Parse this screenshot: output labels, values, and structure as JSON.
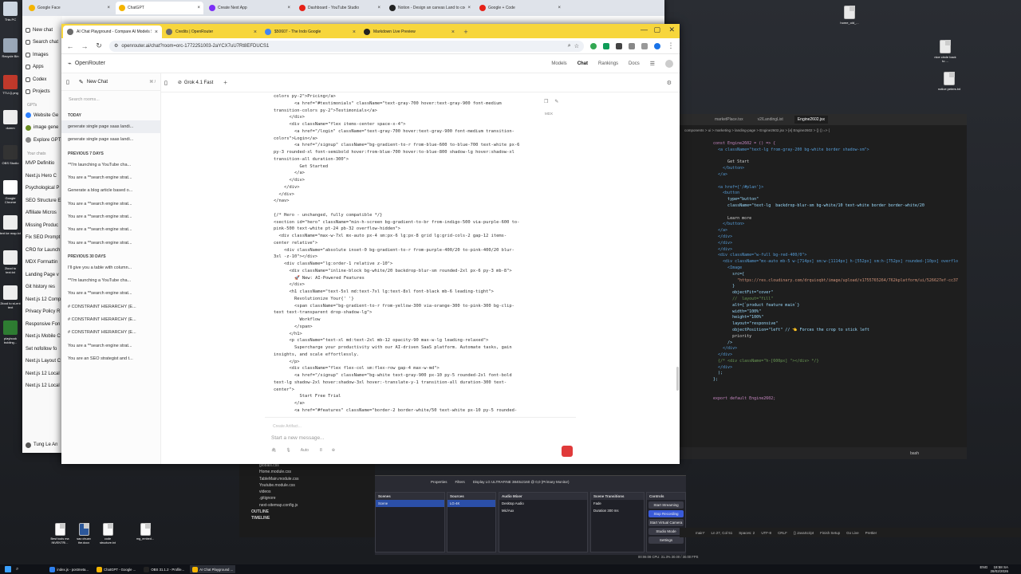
{
  "desktop": {
    "left_icons": [
      {
        "label": "This PC"
      },
      {
        "label": "Recycle Bin"
      },
      {
        "label": "TTU.Q.png"
      },
      {
        "label": "dumm"
      },
      {
        "label": "OBS Studio"
      },
      {
        "label": "Google Chrome"
      },
      {
        "label": "text ke map.txt"
      },
      {
        "label": "2lood to text.txt"
      },
      {
        "label": "2lood to st-ent text"
      },
      {
        "label": "playbook bulding..."
      }
    ],
    "right_icons": [
      {
        "label": "home_old_..."
      },
      {
        "label": "nice circle back to ..."
      },
      {
        "label": "notice peters.txt"
      }
    ],
    "bottom_icons": [
      {
        "label": "Best tools ma INVENTRI..."
      },
      {
        "label": "sao chuan the.docx"
      },
      {
        "label": "code structure.txt"
      },
      {
        "label": "mg_embed..."
      }
    ]
  },
  "chatgpt_window": {
    "tabs": [
      {
        "label": "Google Face",
        "color": "#f4b400",
        "active": false
      },
      {
        "label": "ChatGPT",
        "color": "#f4b400",
        "active": true
      },
      {
        "label": "Create Next App",
        "color": "#7b2ff7",
        "active": false
      },
      {
        "label": "Dashboard - YouTube Studio",
        "color": "#e62117",
        "active": false
      },
      {
        "label": "Notion - Design an canvas Land to code",
        "color": "#222222",
        "active": false
      },
      {
        "label": "Google + Code",
        "color": "#e62117",
        "active": false
      }
    ],
    "sidebar": [
      {
        "label": "New chat"
      },
      {
        "label": "Search chat"
      },
      {
        "label": "Images"
      },
      {
        "label": "Apps"
      },
      {
        "label": "Codex"
      },
      {
        "label": "Projects"
      }
    ],
    "gpts_heading": "GPTs",
    "gpts": [
      {
        "label": "Website Ge"
      },
      {
        "label": "image gene"
      },
      {
        "label": "Explore GPT"
      }
    ],
    "chats_heading": "Your chats",
    "chats": [
      "MVP Definitio",
      "Next.js Hero C",
      "Psychological P",
      "SEO Structure E",
      "Affiliate Micros",
      "Missing Produc",
      "Fix SEO Prompt",
      "CRO for Launch",
      "MDX Formattin",
      "Landing Page v",
      "Git history res",
      "Next.js 12 Comp",
      "Privacy Policy R",
      "Responsive Fon",
      "Next.js Mobile C",
      "Set nofollow fo",
      "Next.js Layout C",
      "Next.js 12 Local",
      "Next.js 12 Local"
    ],
    "user": "Tung Le An"
  },
  "openrouter_window": {
    "tabs": [
      {
        "label": "AI Chat Playground - Compare AI Models Side",
        "color": "#6b6b6b",
        "active": true
      },
      {
        "label": "Credits | OpenRouter",
        "color": "#6b6b6b",
        "active": false
      },
      {
        "label": "$50607 - The Indo Google",
        "color": "#4285f4",
        "active": false
      },
      {
        "label": "Markdown Live Preview",
        "color": "#222222",
        "active": false
      }
    ],
    "url": "openrouter.ai/chat?room=orc-1772251003-2aYCX7uU7Rt8EFDUCS1",
    "brand": "OpenRouter",
    "nav": [
      {
        "label": "Models",
        "active": false
      },
      {
        "label": "Chat",
        "active": true
      },
      {
        "label": "Rankings",
        "active": false
      },
      {
        "label": "Docs",
        "active": false
      }
    ],
    "new_chat": "New Chat",
    "new_chat_shortcut": "⌘ /",
    "search_placeholder": "Search rooms...",
    "sections": [
      {
        "heading": "TODAY",
        "items": [
          "generate single page saas landi...",
          "generate single page saas landi..."
        ]
      },
      {
        "heading": "PREVIOUS 7 DAYS",
        "items": [
          "**I'm launching a YouTube cha...",
          "You are a **search engine strat...",
          "Generate a blog article based o...",
          "You are a **search engine strat...",
          "You are a **search engine strat...",
          "You are a **search engine strat...",
          "You are a **search engine strat..."
        ]
      },
      {
        "heading": "PREVIOUS 30 DAYS",
        "items": [
          "I'll give you a table with column...",
          "**I'm launching a YouTube cha...",
          "You are a **search engine strat...",
          "# CONSTRAINT HIERARCHY (E...",
          "# CONSTRAINT HIERARCHY (E...",
          "# CONSTRAINT HIERARCHY (E...",
          "You are a **search engine strat...",
          "You are an SEO strategist and t..."
        ]
      }
    ],
    "model": "Grok 4.1 Fast",
    "code_badge": "MDX",
    "code_lines": [
      "colors py-2\">Pricing</a>",
      "        <a href=\"#testimonials\" className=\"text-gray-700 hover:text-gray-900 font-medium",
      "transition-colors py-2\">Testimonials</a>",
      "      </div>",
      "      <div className=\"flex items-center space-x-4\">",
      "        <a href=\"/login\" className=\"text-gray-700 hover:text-gray-900 font-medium transition-",
      "colors\">Login</a>",
      "        <a href=\"/signup\" className=\"bg-gradient-to-r from-blue-600 to-blue-700 text-white px-6",
      "py-3 rounded-xl font-semibold hover:from-blue-700 hover:to-blue-800 shadow-lg hover:shadow-xl",
      "transition-all duration-300\">",
      "          Get Started",
      "        </a>",
      "      </div>",
      "    </div>",
      "  </div>",
      "</nav>",
      "",
      "{/* Hero - unchanged, fully compatible */}",
      "<section id=\"hero\" className=\"min-h-screen bg-gradient-to-br from-indigo-500 via-purple-600 to-",
      "pink-500 text-white pt-24 pb-32 overflow-hidden\">",
      "  <div className=\"max-w-7xl mx-auto px-4 sm:px-6 lg:px-8 grid lg:grid-cols-2 gap-12 items-",
      "center relative\">",
      "    <div className=\"absolute inset-0 bg-gradient-to-r from-purple-400/20 to-pink-400/20 blur-",
      "3xl -z-10\"></div>",
      "    <div className=\"lg:order-1 relative z-10\">",
      "      <div className=\"inline-block bg-white/20 backdrop-blur-sm rounded-2xl px-6 py-3 mb-8\">",
      "        🚀 New: AI-Powered Features",
      "      </div>",
      "      <h1 className=\"text-5xl md:text-7xl lg:text-8xl font-black mb-6 leading-tight\">",
      "        Revolutionize Your{' '}",
      "        <span className=\"bg-gradient-to-r from-yellow-300 via-orange-300 to-pink-300 bg-clip-",
      "text text-transparent drop-shadow-lg\">",
      "          Workflow",
      "        </span>",
      "      </h1>",
      "      <p className=\"text-xl md:text-2xl mb-12 opacity-90 max-w-lg leading-relaxed\">",
      "        Supercharge your productivity with our AI-driven SaaS platform. Automate tasks, gain",
      "insights, and scale effortlessly.",
      "      </p>",
      "      <div className=\"flex flex-col sm:flex-row gap-4 max-w-md\">",
      "        <a href=\"/signup\" className=\"bg-white text-gray-900 px-10 py-5 rounded-2xl font-bold",
      "text-lg shadow-2xl hover:shadow-3xl hover:-translate-y-1 transition-all duration-300 text-",
      "center\">",
      "          Start Free Trial",
      "        </a>",
      "        <a href=\"#features\" className=\"border-2 border-white/50 text-white px-10 py-5 rounded-",
      "2xl font-semibold text-lg hover:bg-white/10 backdrop-blur-sm transition-all duration-300 text-"
    ],
    "create_artifact": "Create Artifact...",
    "input_placeholder": "Start a new message...",
    "input_tools": [
      {
        "label": "Auto"
      },
      {
        "label": "8"
      }
    ]
  },
  "vscode": {
    "tabs": [
      "marketPlace.tsx",
      "v2/LandingList",
      "Engine2602.jsx"
    ],
    "breadcrumb": "components > ui > marketing > landing-page > Engine2602.jsx > [e] Engine2602 > {} () => {",
    "code_lines": [
      "const Engine2602 = () => {",
      "  <a className=\"text-lg from-gray-200 bg-white border shadow-sm\">",
      "",
      "      Get Start",
      "    </button>",
      "  </a>",
      "",
      "  <a href={'/#plan'}>",
      "    <button",
      "      type=\"button\"",
      "      className=\"text-lg  backdrop-blur-sm bg-white/10 text-white border border-white/20",
      "",
      "      Learn more",
      "    </button>",
      "  </a>",
      "  </div>",
      "  </div>",
      "  </div>",
      "  <div className=\"w-full bg-red-400/0\">",
      "    <div className=\"mx-auto mb-5 w-[714px] sm:w-[1114px] h-[552px] sm:h-[752px] rounded-[10px] overflo",
      "      <Image",
      "        src={",
      "          \"https://res.cloudinary.com/drquioqbt/image/upload/v1755765264/762kplatform/ui/526627ef-cc37",
      "        }",
      "        objectFit=\"cover\"",
      "        //  layout=\"fill\"",
      "        alt={`product feature main`}",
      "        width=\"100%\"",
      "        height=\"100%\"",
      "        layout=\"responsive\"",
      "        objectPosition=\"left\" // 👈 Forces the crop to stick left",
      "        priority",
      "      />",
      "    </div>",
      "  </div>",
      "  {/* <div className=\"h-[600px] \"></div> */}",
      "  </div>",
      "  );",
      "};",
      "",
      "",
      "export default Engine2602;"
    ],
    "status": [
      "main*",
      "Ln 27, Col 51",
      "Spaces: 2",
      "UTF-8",
      "CRLF",
      "{} JavaScript",
      "Finish Setup",
      "Go Live",
      "Prettier"
    ],
    "terminal_label": "bash"
  },
  "explorer_files": [
    "globals.css",
    "Home.module.css",
    "TableMain.module.css",
    "Youtube.module.css",
    "videos",
    ".gitignore",
    "next-sitemap.config.js",
    "OUTLINE",
    "TIMELINE"
  ],
  "obs": {
    "panels": [
      {
        "title": "Scenes",
        "items": [
          "Scene"
        ]
      },
      {
        "title": "Sources",
        "items": [
          "LG-4K"
        ]
      },
      {
        "title": "Audio Mixer",
        "items": [
          "Desktop Audio",
          "Mic/Aux"
        ]
      },
      {
        "title": "Scene Transitions",
        "items": [
          "Fade",
          "Duration 300 ms"
        ]
      },
      {
        "title": "Controls",
        "items": []
      }
    ],
    "controls": [
      "Start Streaming",
      "Stop Recording",
      "Start Virtual Camera",
      "Studio Mode",
      "Settings"
    ],
    "display_label": "Display  LG ULTRAFINE 3840x2160 @ 0,0 (Primary Monitor)",
    "properties": "Properties",
    "filters": "Filters",
    "source": "LG-4K",
    "status": "00:06:08   CPU: 31.3%   30.00 / 30.00 FPS"
  },
  "taskbar": [
    {
      "label": "index.js - postmeta...",
      "color": "#2f80ed",
      "active": false
    },
    {
      "label": "ChatGPT - Google ...",
      "color": "#f4b400",
      "active": false
    },
    {
      "label": "OBS 31.1.2 - Profile...",
      "color": "#222222",
      "active": false
    },
    {
      "label": "AI Chat Playground ...",
      "color": "#f4b400",
      "active": true
    }
  ],
  "clock": {
    "time": "18:58 SA",
    "date": "28/02/2026",
    "lang": "ENG"
  }
}
